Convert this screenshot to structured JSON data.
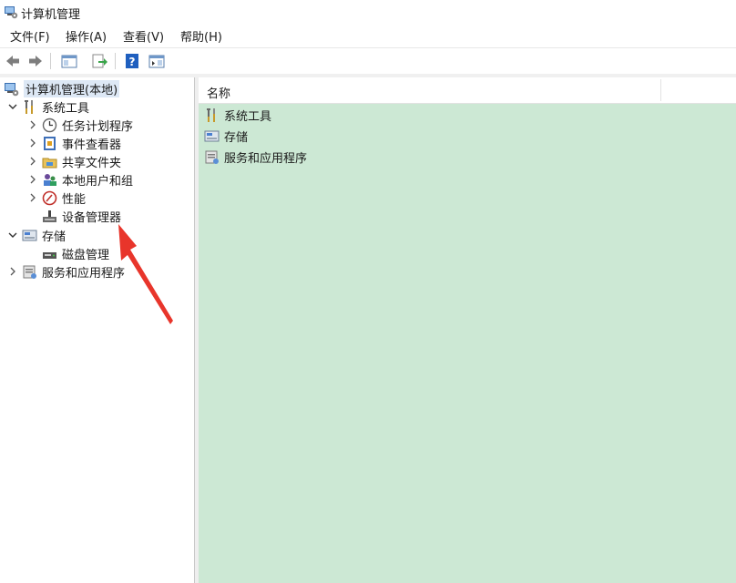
{
  "window": {
    "title": "计算机管理"
  },
  "menu": {
    "file": "文件(F)",
    "action": "操作(A)",
    "view": "查看(V)",
    "help": "帮助(H)"
  },
  "tree": {
    "root": "计算机管理(本地)",
    "system_tools": "系统工具",
    "task_scheduler": "任务计划程序",
    "event_viewer": "事件查看器",
    "shared_folders": "共享文件夹",
    "local_users": "本地用户和组",
    "performance": "性能",
    "device_manager": "设备管理器",
    "storage": "存储",
    "disk_management": "磁盘管理",
    "services_apps": "服务和应用程序"
  },
  "list": {
    "column_name": "名称",
    "items": [
      "系统工具",
      "存储",
      "服务和应用程序"
    ]
  },
  "colors": {
    "content_bg": "#cce8d4",
    "selection": "#dde8f5",
    "annotation_arrow": "#e8352b"
  }
}
